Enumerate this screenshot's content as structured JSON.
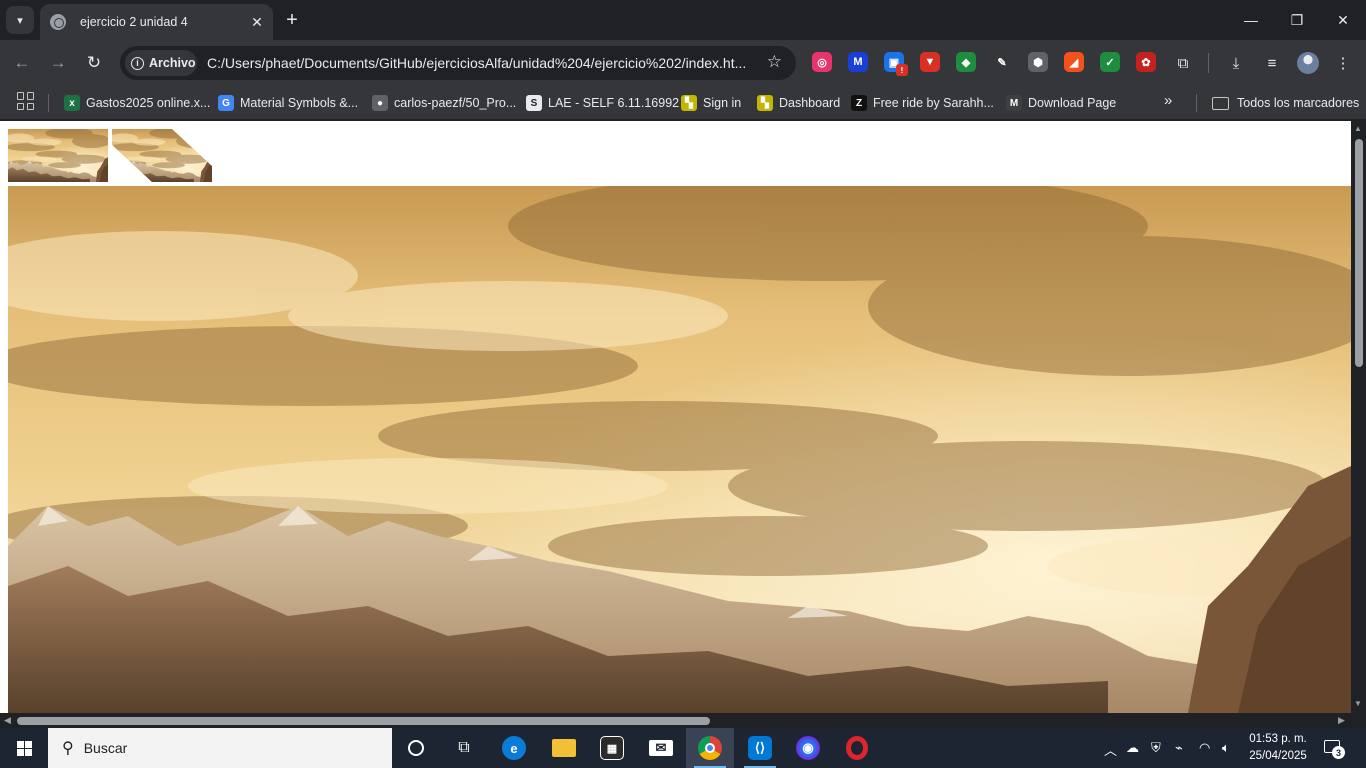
{
  "tab": {
    "title": "ejercicio 2 unidad 4",
    "close_glyph": "✕"
  },
  "window": {
    "minimize": "—",
    "restore": "❐",
    "close": "✕"
  },
  "omnibox": {
    "chip_label": "Archivo",
    "url": "C:/Users/phaet/Documents/GitHub/ejerciciosAlfa/unidad%204/ejercicio%202/index.ht..."
  },
  "extensions": [
    {
      "name": "extension-1-icon",
      "color": "#e8336d",
      "glyph": "◎"
    },
    {
      "name": "extension-2-icon",
      "color": "#1a3fd6",
      "glyph": "M"
    },
    {
      "name": "extension-3-icon",
      "color": "#1a73e8",
      "glyph": "▣",
      "badge": "!"
    },
    {
      "name": "extension-4-icon",
      "color": "#d93025",
      "glyph": "▼"
    },
    {
      "name": "extension-5-icon",
      "color": "#1e8e3e",
      "glyph": "◆"
    },
    {
      "name": "extension-6-icon",
      "color": "#35363a",
      "glyph": "✎"
    },
    {
      "name": "extension-7-icon",
      "color": "#5f6368",
      "glyph": "⬢"
    },
    {
      "name": "extension-8-icon",
      "color": "#f4511e",
      "glyph": "◢"
    },
    {
      "name": "extension-9-icon",
      "color": "#1e8e3e",
      "glyph": "✓"
    },
    {
      "name": "extension-10-icon",
      "color": "#c5221f",
      "glyph": "✿"
    }
  ],
  "bookmarks": [
    {
      "name": "bookmark-gastos",
      "label": "Gastos2025 online.x...",
      "icon_color": "#1e7145",
      "glyph": "x"
    },
    {
      "name": "bookmark-material-symbols",
      "label": "Material Symbols &...",
      "icon_color": "#4285f4",
      "glyph": "G"
    },
    {
      "name": "bookmark-github",
      "label": "carlos-paezf/50_Pro...",
      "icon_color": "#5f6368",
      "glyph": "●"
    },
    {
      "name": "bookmark-lae",
      "label": "LAE - SELF 6.11.16992",
      "icon_color": "#e8eaed",
      "glyph": "S"
    },
    {
      "name": "bookmark-sign-in",
      "label": "Sign in",
      "icon_color": "#c2b700",
      "glyph": "▚"
    },
    {
      "name": "bookmark-dashboard",
      "label": "Dashboard",
      "icon_color": "#c2b700",
      "glyph": "▚"
    },
    {
      "name": "bookmark-free-ride",
      "label": "Free ride by Sarahh...",
      "icon_color": "#111111",
      "glyph": "Z"
    },
    {
      "name": "bookmark-download-page",
      "label": "Download Page",
      "icon_color": "#3c4043",
      "glyph": "M"
    }
  ],
  "bookmarks_more": "»",
  "all_bookmarks_label": "Todos los marcadores",
  "taskbar": {
    "search_label": "Buscar",
    "time": "01:53 p. m.",
    "date": "25/04/2025",
    "notification_count": "3"
  }
}
